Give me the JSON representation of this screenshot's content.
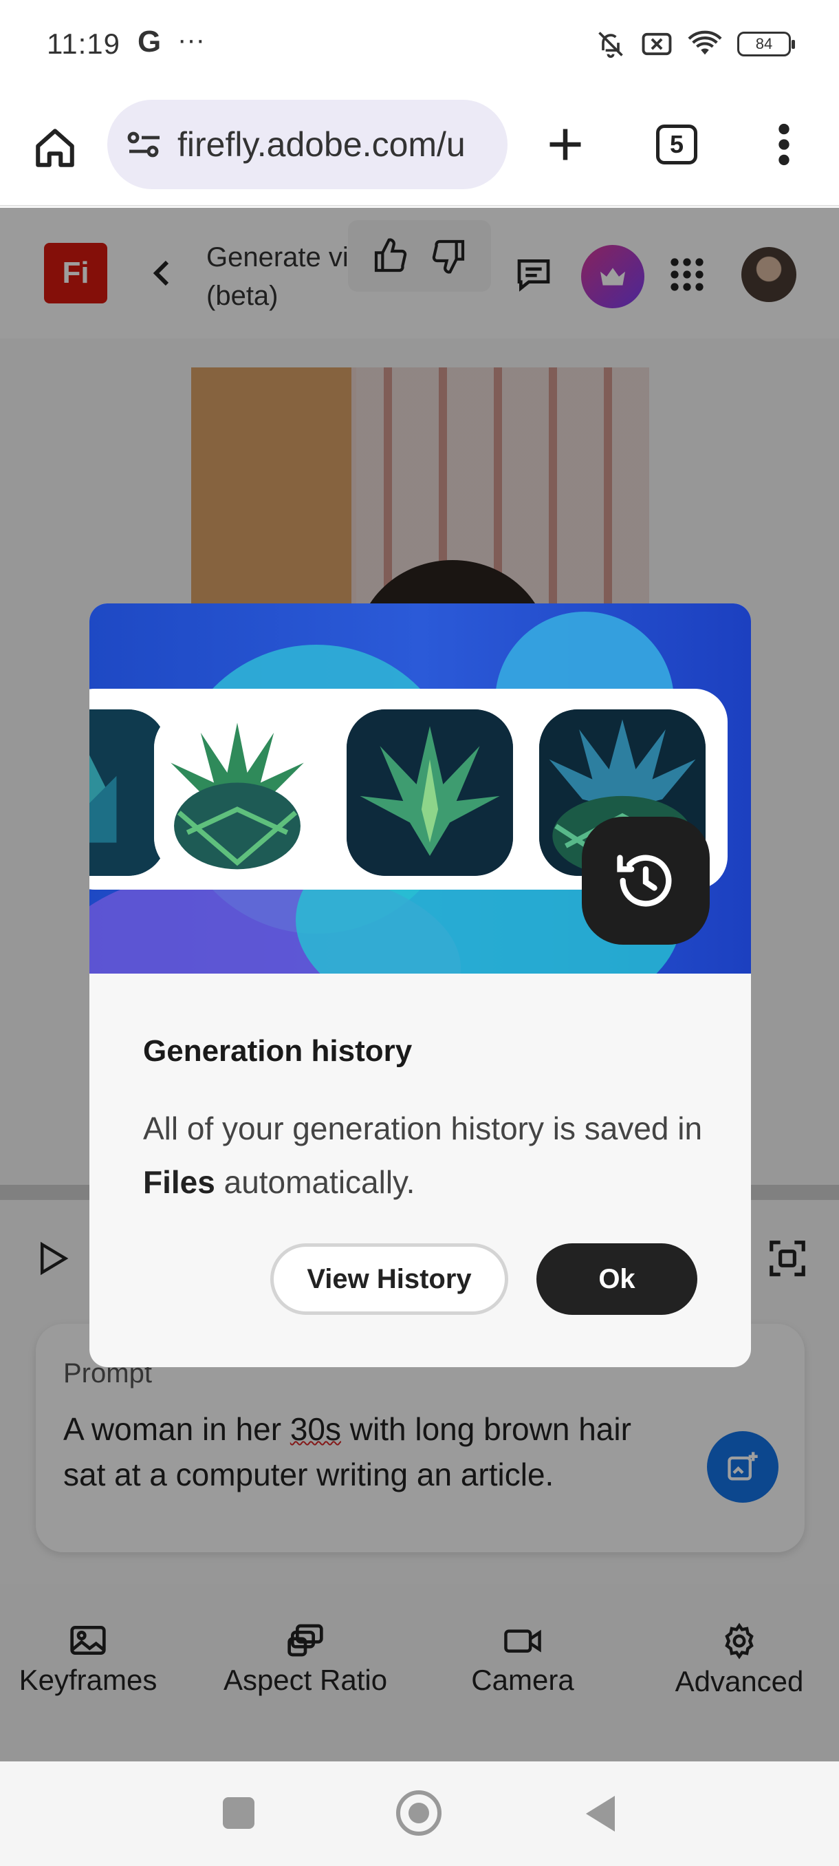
{
  "status_bar": {
    "time": "11:19",
    "g_label": "G",
    "more_label": "···",
    "battery": "84"
  },
  "browser": {
    "url": "firefly.adobe.com/u",
    "tab_count": "5"
  },
  "app": {
    "logo_text": "Fi",
    "title": "Generate video (beta)"
  },
  "prompt": {
    "label": "Prompt",
    "text_before": "A woman in her ",
    "text_flagged": "30s",
    "text_after": " with long brown hair sat at a computer writing an article."
  },
  "toolbar": {
    "items": [
      {
        "label": "Keyframes",
        "icon": "image-icon"
      },
      {
        "label": "Aspect Ratio",
        "icon": "aspect-ratio-icon"
      },
      {
        "label": "Camera",
        "icon": "camera-icon"
      },
      {
        "label": "Advanced",
        "icon": "gear-icon"
      }
    ]
  },
  "dialog": {
    "title": "Generation history",
    "body_before": "All of your generation history is saved in ",
    "body_bold": "Files",
    "body_after": " automatically.",
    "secondary_label": "View History",
    "primary_label": "Ok"
  },
  "colors": {
    "brand_red": "#d6190f",
    "generate_blue": "#1473e6",
    "dialog_primary": "#222222"
  }
}
